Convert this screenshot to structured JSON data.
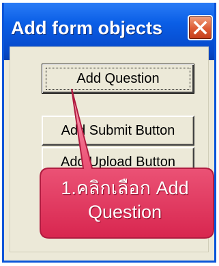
{
  "window": {
    "title": "Add form objects",
    "close_symbol": "✕"
  },
  "buttons": {
    "add_question": "Add Question",
    "add_submit": "Add Submit Button",
    "add_upload": "Add Upload Button"
  },
  "annotation": {
    "line1": "1.คลิกเลือก Add",
    "line2": "Question"
  },
  "colors": {
    "titlebar": "#0a5ee6",
    "callout_fill": "#ee4a6e",
    "close_button": "#dc5a34"
  }
}
